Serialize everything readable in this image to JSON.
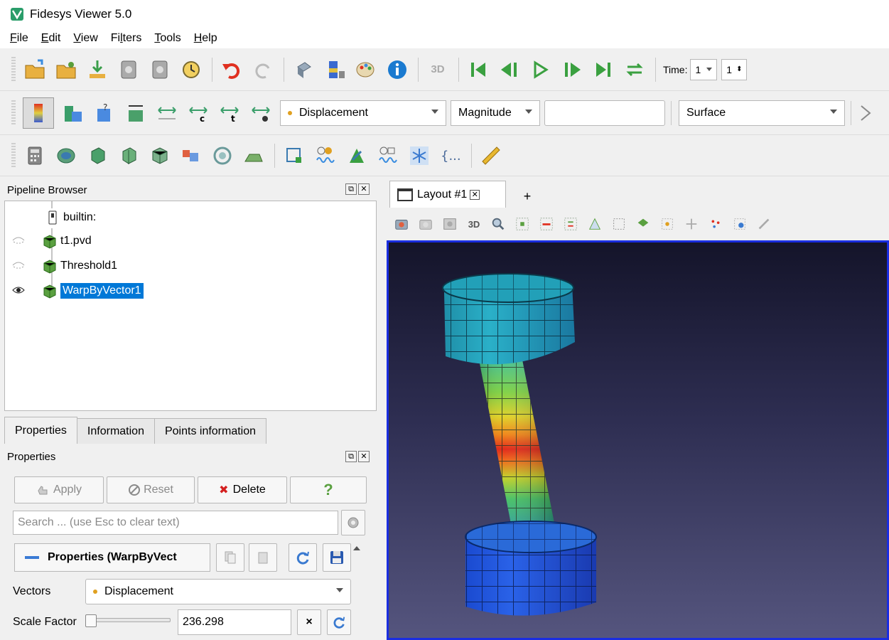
{
  "window": {
    "title": "Fidesys Viewer 5.0"
  },
  "menu": [
    {
      "pre": "",
      "u": "F",
      "post": "ile"
    },
    {
      "pre": "",
      "u": "E",
      "post": "dit"
    },
    {
      "pre": "",
      "u": "V",
      "post": "iew"
    },
    {
      "pre": "Fi",
      "u": "l",
      "post": "ters"
    },
    {
      "pre": "",
      "u": "T",
      "post": "ools"
    },
    {
      "pre": "",
      "u": "H",
      "post": "elp"
    }
  ],
  "toolbar1": {
    "time_label": "Time:",
    "time_value": "1",
    "time_index": "1",
    "three_d_label": "3D"
  },
  "toolbar2": {
    "color_by": "Displacement",
    "component": "Magnitude",
    "representation": "Surface"
  },
  "pipeline": {
    "header": "Pipeline Browser",
    "items": [
      {
        "label": "builtin:",
        "visible": null
      },
      {
        "label": "t1.pvd",
        "visible": false
      },
      {
        "label": "Threshold1",
        "visible": false
      },
      {
        "label": "WarpByVector1",
        "visible": true,
        "selected": true
      }
    ]
  },
  "tabs": [
    "Properties",
    "Information",
    "Points information"
  ],
  "properties": {
    "header": "Properties",
    "apply": "Apply",
    "reset": "Reset",
    "delete": "Delete",
    "help": "?",
    "search_placeholder": "Search ... (use Esc to clear text)",
    "section": "Properties (WarpByVect",
    "vectors_label": "Vectors",
    "vectors_value": "Displacement",
    "scale_label": "Scale Factor",
    "scale_value": "236.298"
  },
  "layout": {
    "tab_label": "Layout #1",
    "add_label": "+",
    "three_d_label": "3D"
  },
  "colors": {
    "selection": "#0078d7",
    "viewport_border": "#1a2de0",
    "delete_red": "#d42020"
  }
}
